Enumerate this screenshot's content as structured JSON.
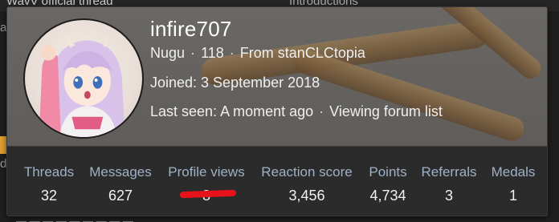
{
  "background": {
    "top_left_fragment": "WavV official thread",
    "top_right_fragment": "Introductions",
    "left_fragment_a": "a",
    "left_fragment_d": "d",
    "bottom_fragment": "— — — — — — — — —"
  },
  "member": {
    "username": "infire707",
    "rank": "Nugu",
    "level": "118",
    "location": "From stanCLCtopia",
    "joined": "Joined: 3 September 2018",
    "last_seen": "Last seen: A moment ago",
    "activity": "Viewing forum list",
    "separator": "·"
  },
  "stats": [
    {
      "label": "Threads",
      "value": "32"
    },
    {
      "label": "Messages",
      "value": "627"
    },
    {
      "label": "Profile views",
      "value": "8"
    },
    {
      "label": "Reaction score",
      "value": "3,456"
    },
    {
      "label": "Points",
      "value": "4,734"
    },
    {
      "label": "Referrals",
      "value": "3"
    },
    {
      "label": "Medals",
      "value": "1"
    }
  ],
  "colors": {
    "card_bg": "#2b2b2b",
    "stat_label": "#9fb1c6",
    "annotation_red": "#e8121b"
  }
}
